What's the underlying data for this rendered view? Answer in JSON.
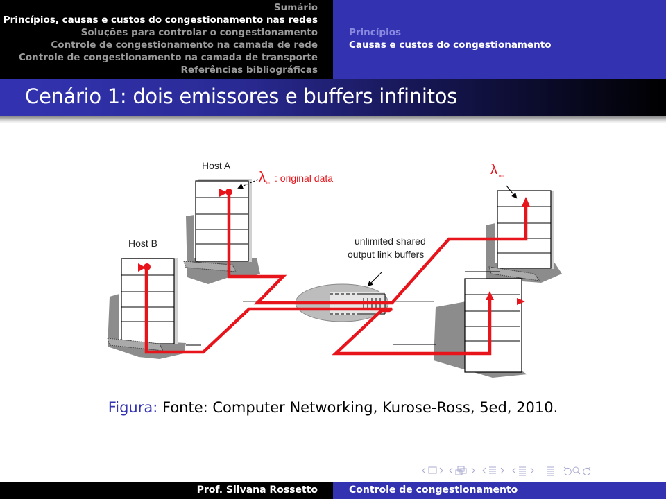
{
  "header": {
    "toc": [
      {
        "label": "Sumário",
        "active": false
      },
      {
        "label": "Princípios, causas e custos do congestionamento nas redes",
        "active": true
      },
      {
        "label": "Soluções para controlar o congestionamento",
        "active": false
      },
      {
        "label": "Controle de congestionamento na camada de rede",
        "active": false
      },
      {
        "label": "Controle de congestionamento na camada de transporte",
        "active": false
      },
      {
        "label": "Referências bibliográficas",
        "active": false
      }
    ],
    "section": "Princípios",
    "subsection": "Causas e custos do congestionamento"
  },
  "slide": {
    "title": "Cenário 1: dois emissores e buffers infinitos"
  },
  "figure": {
    "host_a_label": "Host A",
    "host_b_label": "Host B",
    "lambda_in_symbol": "λ",
    "lambda_in_sub": "in",
    "lambda_in_text": ": original data",
    "lambda_out_symbol": "λ",
    "lambda_out_sub": "out",
    "router_label_line1": "unlimited shared",
    "router_label_line2": "output link buffers",
    "path_color": "#e8141b"
  },
  "caption": {
    "label": "Figura:",
    "text": "Fonte: Computer Networking, Kurose-Ross, 5ed, 2010."
  },
  "navigation": {
    "icons": [
      "prev-frame",
      "frame",
      "next-frame",
      "prev-slide",
      "slide",
      "next-slide",
      "prev-section",
      "section",
      "next-section",
      "prev-subsection",
      "subsection",
      "next-subsection",
      "toc",
      "undo",
      "search",
      "redo"
    ]
  },
  "footer": {
    "author": "Prof. Silvana Rossetto",
    "title": "Controle de congestionamento"
  },
  "colors": {
    "beamer_blue": "#3333b2",
    "header_black": "#000000",
    "accent_red": "#e8141b"
  }
}
